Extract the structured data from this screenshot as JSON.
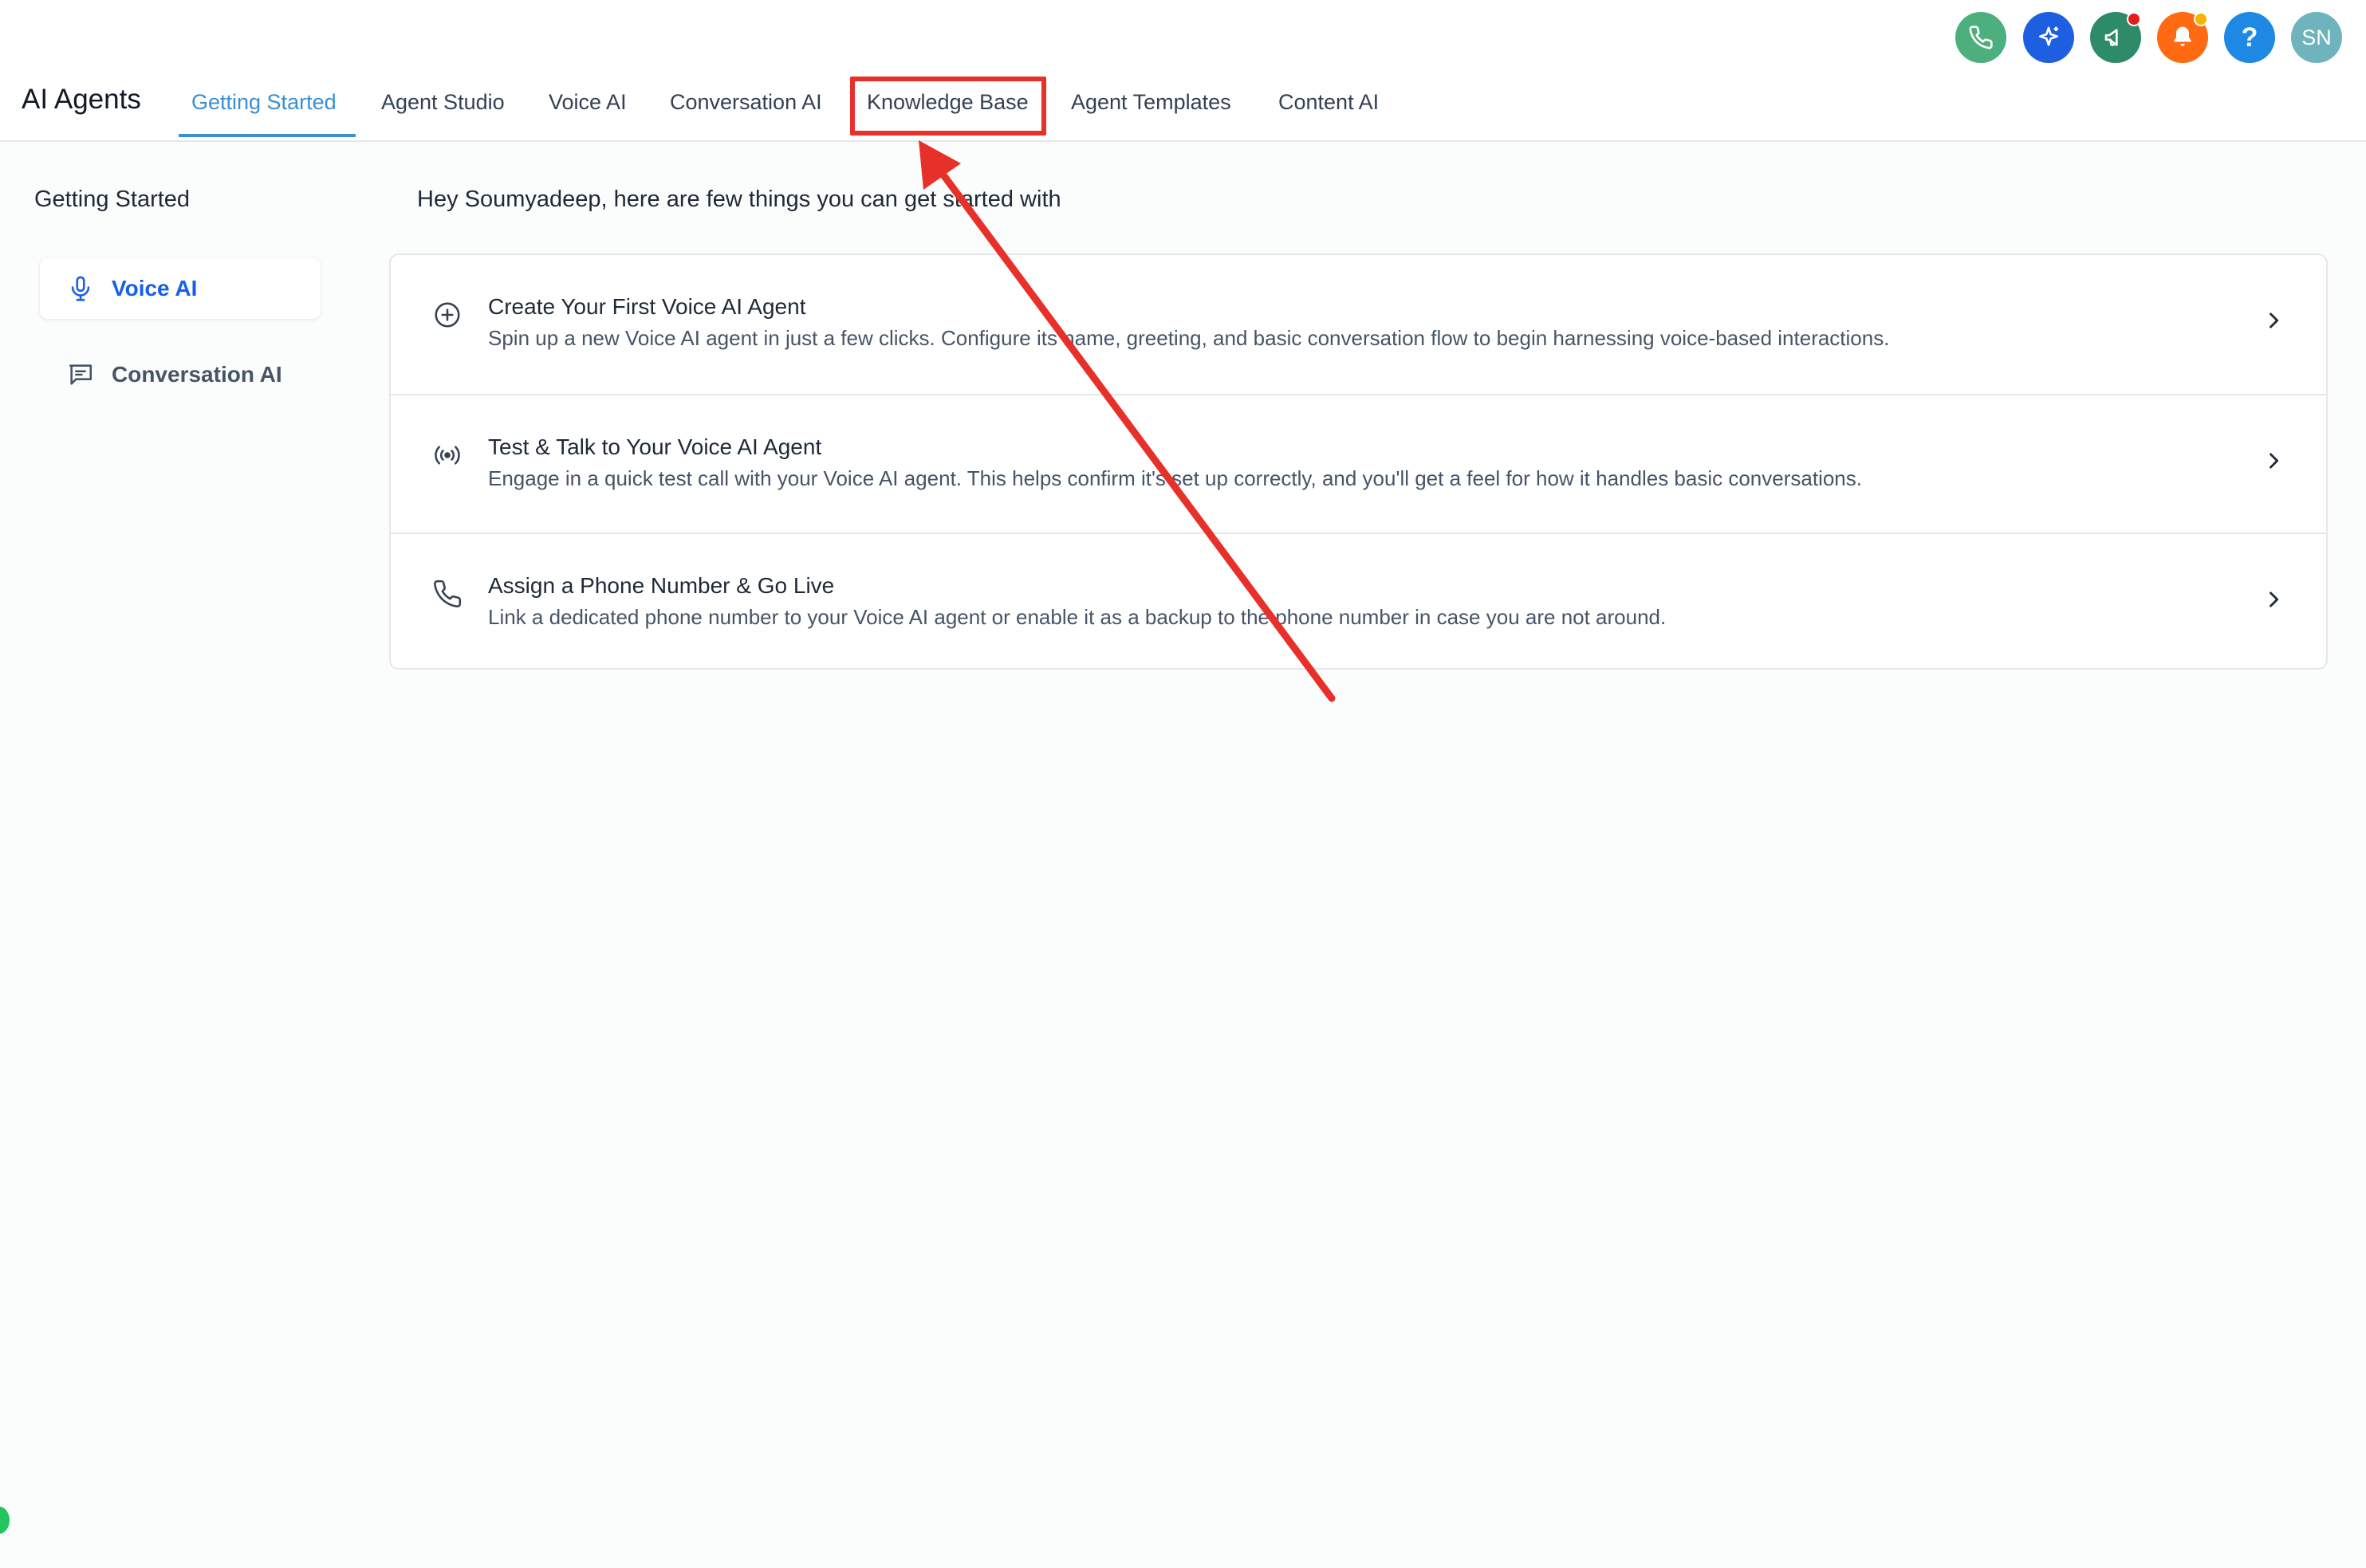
{
  "header": {
    "app_title": "AI Agents",
    "tabs": [
      {
        "label": "Getting Started",
        "active": true
      },
      {
        "label": "Agent Studio",
        "active": false
      },
      {
        "label": "Voice AI",
        "active": false
      },
      {
        "label": "Conversation AI",
        "active": false
      },
      {
        "label": "Knowledge Base",
        "active": false
      },
      {
        "label": "Agent Templates",
        "active": false
      },
      {
        "label": "Content AI",
        "active": false
      }
    ],
    "icons": [
      {
        "name": "phone-icon",
        "color": "#4caf7d"
      },
      {
        "name": "sparkles-icon",
        "color": "#1d5fe0"
      },
      {
        "name": "megaphone-icon",
        "color": "#2e8b67",
        "badge_color": "#e21d1d"
      },
      {
        "name": "bell-icon",
        "color": "#ff6a13",
        "badge_color": "#f5b400"
      },
      {
        "name": "help-icon",
        "color": "#1e88e5",
        "text": "?"
      },
      {
        "name": "avatar",
        "color": "#6fb3bd",
        "text": "SN"
      }
    ],
    "accent_color": "#3b8fd4"
  },
  "sidebar": {
    "heading": "Getting Started",
    "items": [
      {
        "label": "Voice AI",
        "icon": "microphone-icon",
        "active": true
      },
      {
        "label": "Conversation AI",
        "icon": "chat-icon",
        "active": false
      }
    ]
  },
  "main": {
    "greeting": "Hey Soumyadeep, here are few things you can get started with",
    "steps": [
      {
        "icon": "plus-circle-icon",
        "title": "Create Your First Voice AI Agent",
        "description": "Spin up a new Voice AI agent in just a few clicks. Configure its name, greeting, and basic conversation flow to begin harnessing voice-based interactions."
      },
      {
        "icon": "broadcast-icon",
        "title": "Test & Talk to Your Voice AI Agent",
        "description": "Engage in a quick test call with your Voice AI agent. This helps confirm it's set up correctly, and you'll get a feel for how it handles basic conversations."
      },
      {
        "icon": "phone-icon",
        "title": "Assign a Phone Number & Go Live",
        "description": "Link a dedicated phone number to your Voice AI agent or enable it as a backup to the phone number in case you are not around."
      }
    ]
  },
  "annotation": {
    "color": "#e8302a"
  }
}
